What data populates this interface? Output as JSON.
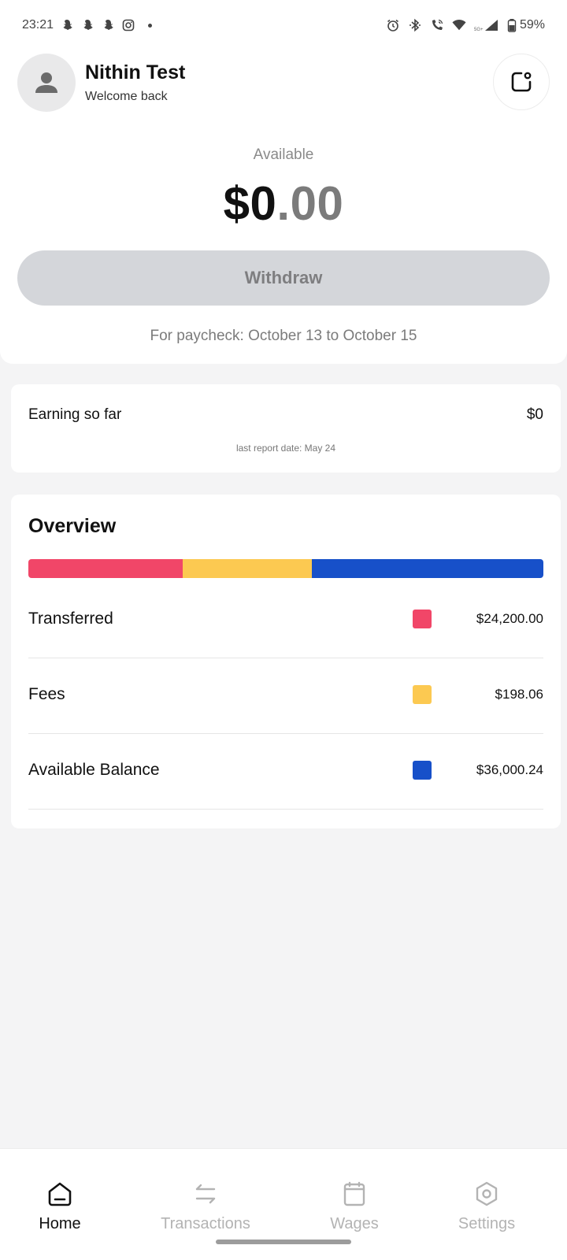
{
  "status_bar": {
    "time": "23:21",
    "battery": "59%",
    "network": "5G+"
  },
  "header": {
    "user_name": "Nithin Test",
    "welcome": "Welcome back"
  },
  "balance": {
    "label": "Available",
    "amount_major": "$0",
    "amount_minor": ".00",
    "withdraw_label": "Withdraw",
    "paycheck_text": "For paycheck: October 13 to October 15"
  },
  "earnings": {
    "label": "Earning so far",
    "value": "$0",
    "report_date": "last report date: May 24"
  },
  "overview": {
    "title": "Overview",
    "items": [
      {
        "label": "Transferred",
        "value": "$24,200.00",
        "color": "#f14668",
        "share": 0.3
      },
      {
        "label": "Fees",
        "value": "$198.06",
        "color": "#fcc951",
        "share": 0.25
      },
      {
        "label": "Available Balance",
        "value": "$36,000.24",
        "color": "#1750c9",
        "share": 0.45
      }
    ]
  },
  "nav": {
    "items": [
      {
        "label": "Home",
        "icon": "home-icon",
        "active": true
      },
      {
        "label": "Transactions",
        "icon": "transactions-icon",
        "active": false
      },
      {
        "label": "Wages",
        "icon": "calendar-icon",
        "active": false
      },
      {
        "label": "Settings",
        "icon": "gear-icon",
        "active": false
      }
    ],
    "active_color": "#111111",
    "inactive_color": "#b3b3b3"
  }
}
